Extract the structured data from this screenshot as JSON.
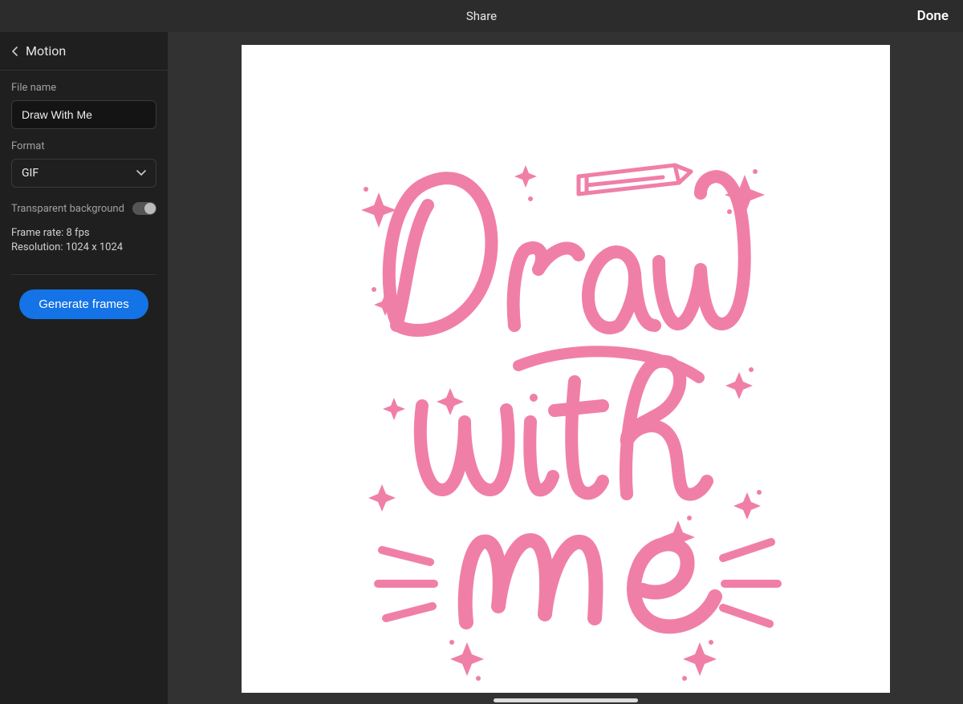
{
  "topbar": {
    "title": "Share",
    "done": "Done"
  },
  "panel": {
    "title": "Motion",
    "fileNameLabel": "File name",
    "fileName": "Draw With Me",
    "formatLabel": "Format",
    "format": "GIF",
    "transparentLabel": "Transparent background",
    "transparent": false,
    "frameRateLabel": "Frame rate:",
    "frameRate": "8 fps",
    "resolutionLabel": "Resolution:",
    "resolution": "1024 x 1024",
    "generate": "Generate frames"
  },
  "artwork": {
    "line1": "Draw",
    "line2": "with",
    "line3": "me",
    "color": "#f07fa8"
  }
}
